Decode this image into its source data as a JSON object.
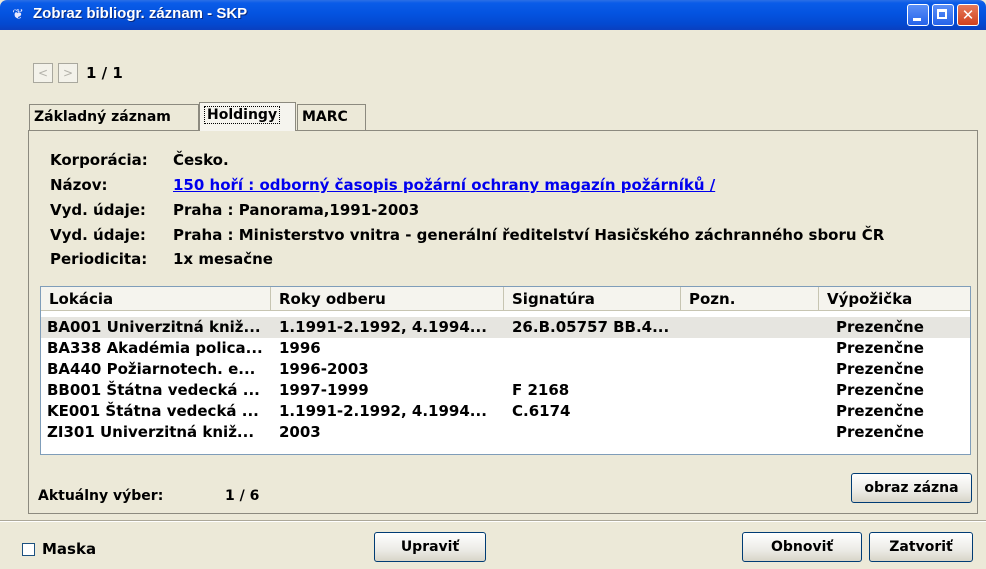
{
  "window": {
    "title": "Zobraz bibliogr. záznam - SKP",
    "close_glyph": "✕"
  },
  "navigation": {
    "prev_glyph": "<",
    "next_glyph": ">",
    "counter": "1 / 1"
  },
  "tabs": [
    {
      "label": "Základný záznam"
    },
    {
      "label": "Holdingy",
      "active": true
    },
    {
      "label": "MARC"
    }
  ],
  "record": {
    "fields": [
      {
        "label": "Korporácia:",
        "value": "Česko."
      },
      {
        "label": "Názov:",
        "value": "150 hoří : odborný časopis požární ochrany magazín požárníků /"
      },
      {
        "label": "Vyd. údaje:",
        "value": "Praha : Panorama,1991-2003"
      },
      {
        "label": "Vyd. údaje:",
        "value": "Praha : Ministerstvo vnitra - generální ředitelství Hasičského záchranného sboru ČR"
      },
      {
        "label": "Periodicita:",
        "value": "1x mesačne"
      }
    ]
  },
  "holdings": {
    "columns": [
      "Lokácia",
      "Roky odberu",
      "Signatúra",
      "Pozn.",
      "Výpožička"
    ],
    "rows": [
      [
        "BA001 Univerzitná kniž...",
        "1.1991-2.1992, 4.1994...",
        "26.B.05757 BB.4...",
        "",
        "Prezenčne"
      ],
      [
        "BA338 Akadémia polica...",
        "1996",
        "",
        "",
        "Prezenčne"
      ],
      [
        "BA440 Požiarnotech. e...",
        "1996-2003",
        "",
        "",
        "Prezenčne"
      ],
      [
        "BB001 Štátna vedecká ...",
        "1997-1999",
        "F 2168",
        "",
        "Prezenčne"
      ],
      [
        "KE001 Štátna vedecká ...",
        "1.1991-2.1992, 4.1994...",
        "C.6174",
        "",
        "Prezenčne"
      ],
      [
        "ZI301 Univerzitná kniž...",
        "2003",
        "",
        "",
        "Prezenčne"
      ]
    ],
    "selected_row": 0
  },
  "selection": {
    "label": "Aktuálny výber:",
    "value": "1 / 6"
  },
  "buttons": {
    "view_record": "obraz zázna",
    "edit": "Upraviť",
    "refresh": "Obnoviť",
    "close": "Zatvoriť"
  },
  "mask": {
    "label": "Maska",
    "checked": false
  }
}
